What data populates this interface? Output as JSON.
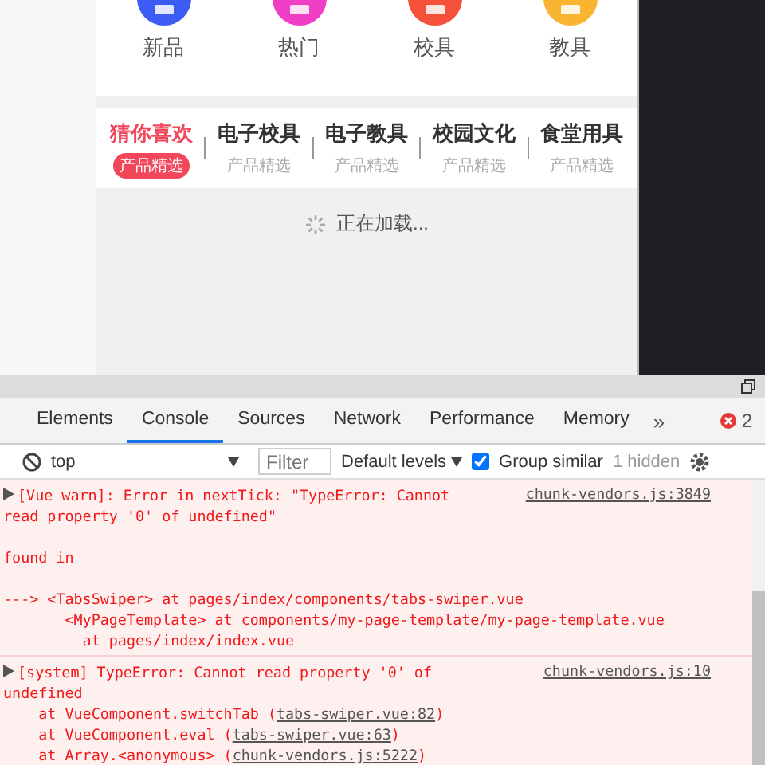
{
  "phone": {
    "categories": [
      {
        "label": "新品",
        "color": "#3b5cf5"
      },
      {
        "label": "热门",
        "color": "#f03fc4"
      },
      {
        "label": "校具",
        "color": "#f5503a"
      },
      {
        "label": "教具",
        "color": "#f9b531"
      }
    ],
    "tabs": [
      {
        "title": "猜你喜欢",
        "subtitle": "产品精选",
        "selected": true
      },
      {
        "title": "电子校具",
        "subtitle": "产品精选",
        "selected": false
      },
      {
        "title": "电子教具",
        "subtitle": "产品精选",
        "selected": false
      },
      {
        "title": "校园文化",
        "subtitle": "产品精选",
        "selected": false
      },
      {
        "title": "食堂用具",
        "subtitle": "产品精选",
        "selected": false
      }
    ],
    "loading": "正在加载..."
  },
  "devtools": {
    "tabs": [
      {
        "label": "Elements",
        "selected": false
      },
      {
        "label": "Console",
        "selected": true
      },
      {
        "label": "Sources",
        "selected": false
      },
      {
        "label": "Network",
        "selected": false
      },
      {
        "label": "Performance",
        "selected": false
      },
      {
        "label": "Memory",
        "selected": false
      }
    ],
    "more": "»",
    "error_count": "2",
    "toolbar": {
      "context": "top",
      "filter_placeholder": "Filter",
      "levels": "Default levels",
      "group_similar": {
        "label": "Group similar",
        "checked": true
      },
      "hidden": "1 hidden"
    },
    "messages": [
      {
        "source": "chunk-vendors.js:3849",
        "blocks": [
          {
            "lines": [
              {
                "text": "[Vue warn]: Error in nextTick: \"TypeError: Cannot"
              },
              {
                "text": "read property '0' of undefined\""
              }
            ]
          },
          {
            "lines": [
              {
                "text": "found in"
              }
            ]
          },
          {
            "lines": [
              {
                "text": "---> <TabsSwiper> at pages/index/components/tabs-swiper.vue"
              },
              {
                "text": "       <MyPageTemplate> at components/my-page-template/my-page-template.vue"
              },
              {
                "text": "         at pages/index/index.vue"
              }
            ]
          }
        ]
      },
      {
        "source": "chunk-vendors.js:10",
        "blocks": [
          {
            "lines": [
              {
                "text": "[system] TypeError: Cannot read property '0' of"
              },
              {
                "text": "undefined"
              },
              {
                "text": "    at VueComponent.switchTab (",
                "link": "tabs-swiper.vue:82",
                "after": ")"
              },
              {
                "text": "    at VueComponent.eval (",
                "link": "tabs-swiper.vue:63",
                "after": ")"
              },
              {
                "text": "    at Array.<anonymous> (",
                "link": "chunk-vendors.js:5222",
                "after": ")"
              }
            ]
          }
        ]
      }
    ]
  }
}
